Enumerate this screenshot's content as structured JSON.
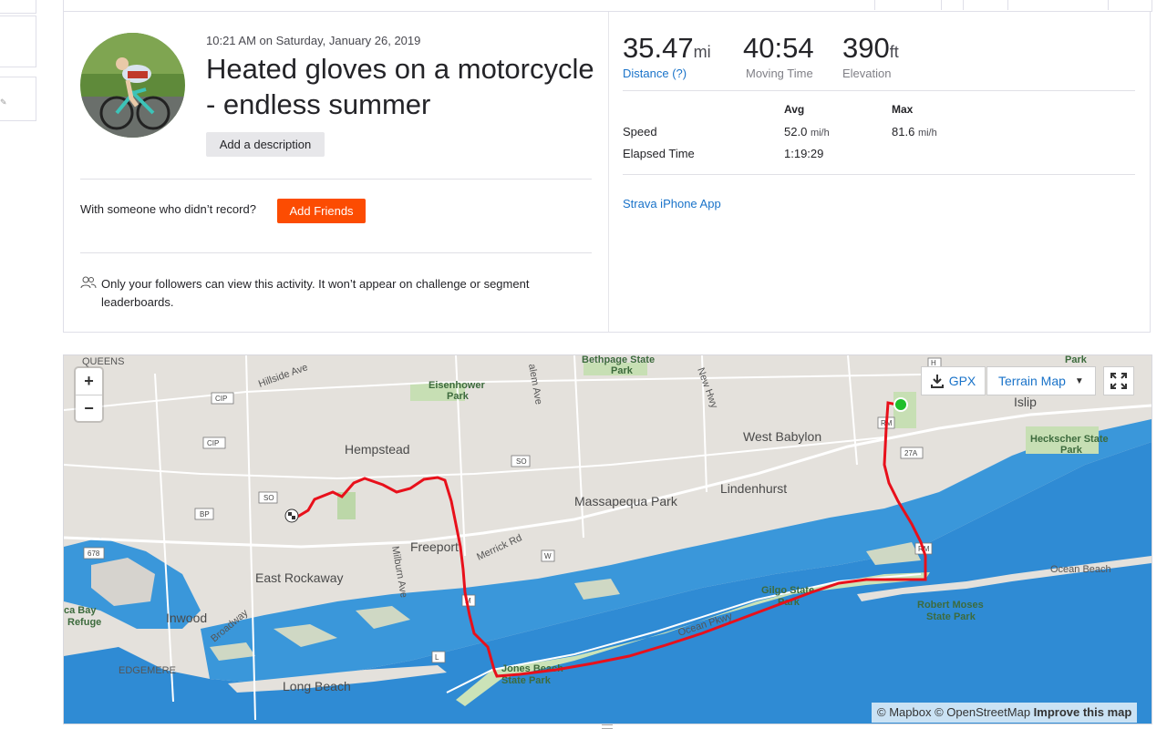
{
  "activity": {
    "timestamp": "10:21 AM on Saturday, January 26, 2019",
    "title": "Heated gloves on a motorcycle - endless summer",
    "add_description_label": "Add a description",
    "friends_prompt": "With someone who didn’t record?",
    "add_friends_label": "Add Friends",
    "privacy_text": "Only your followers can view this activity. It won’t appear on challenge or segment leaderboards."
  },
  "stats": {
    "distance": {
      "value": "35.47",
      "unit": "mi",
      "label": "Distance (?)"
    },
    "moving_time": {
      "value": "40:54",
      "label": "Moving Time"
    },
    "elevation": {
      "value": "390",
      "unit": "ft",
      "label": "Elevation"
    },
    "table": {
      "col_avg": "Avg",
      "col_max": "Max",
      "speed_label": "Speed",
      "speed_avg": "52.0",
      "speed_max": "81.6",
      "speed_unit": "mi/h",
      "elapsed_label": "Elapsed Time",
      "elapsed_value": "1:19:29"
    },
    "device": "Strava iPhone App"
  },
  "map": {
    "zoom_in": "+",
    "zoom_out": "−",
    "gpx_label": "GPX",
    "map_type_label": "Terrain Map",
    "attribution_mapbox": "© Mapbox",
    "attribution_osm": "© OpenStreetMap",
    "attribution_improve": "Improve this map",
    "labels": {
      "queens": "QUEENS",
      "hillside": "Hillside Ave",
      "eisenhower": "Eisenhower",
      "eisenhower2": "Park",
      "bethpage": "Bethpage State",
      "bethpage2": "Park",
      "hempstead": "Hempstead",
      "west_babylon": "West Babylon",
      "lindenhurst": "Lindenhurst",
      "massapequa": "Massapequa Park",
      "freeport": "Freeport",
      "merrick": "Merrick Rd",
      "east_rockaway": "East Rockaway",
      "inwood": "Inwood",
      "broadway": "Broadway",
      "edgemere": "EDGEMERE",
      "long_beach": "Long Beach",
      "jones_beach": "Jones Beach",
      "jones_beach2": "State Park",
      "gilgo": "Gilgo State",
      "gilgo2": "Park",
      "ocean_pkwy": "Ocean Pkwy",
      "robert_moses": "Robert Moses",
      "robert_moses2": "State Park",
      "ocean_beach": "Ocean Beach",
      "heckscher": "Heckscher State",
      "heckscher2": "Park",
      "islip": "Islip",
      "park_top": "Park",
      "jamaica_bay": "ca Bay",
      "jamaica_bay2": "Refuge",
      "milburn": "Milburn Ave",
      "new_hwy": "New Hwy",
      "salem": "alem Ave"
    },
    "shields": [
      "CIP",
      "CIP",
      "SO",
      "SO",
      "BP",
      "678",
      "W",
      "M",
      "L",
      "RM",
      "RM",
      "27A",
      "H"
    ]
  },
  "colors": {
    "brand": "#fc4c02",
    "link": "#1a73c9",
    "route": "#e8101b",
    "start_marker": "#1fbf2b"
  }
}
